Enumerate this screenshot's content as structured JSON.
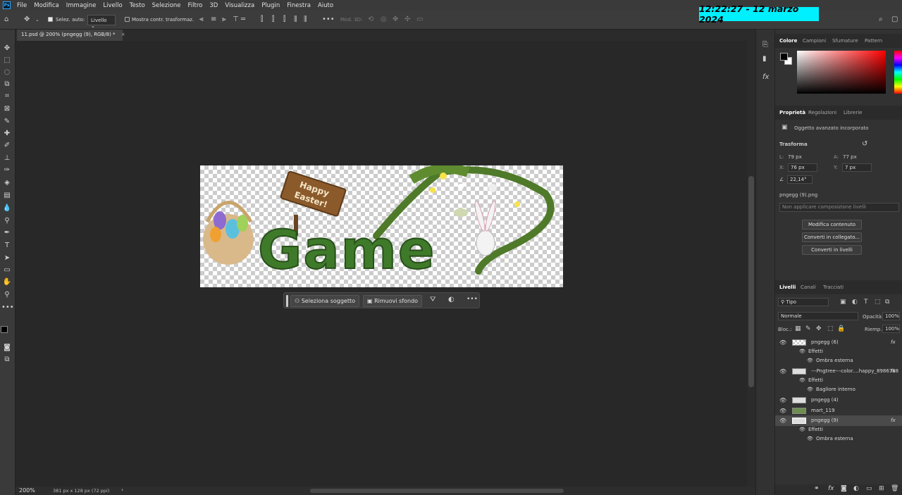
{
  "menubar": {
    "logo": "Ps",
    "items": [
      "File",
      "Modifica",
      "Immagine",
      "Livello",
      "Testo",
      "Selezione",
      "Filtro",
      "3D",
      "Visualizza",
      "Plugin",
      "Finestra",
      "Aiuto"
    ]
  },
  "clock": "12:22:27  -  12 marzo 2024",
  "options": {
    "auto_select_label": "Selez. auto:",
    "auto_select_value": "Livello",
    "transform_controls_label": "Mostra contr. trasformaz.",
    "mode_3d_label": "Mod. 3D:"
  },
  "document": {
    "tab_title": "11.psd @ 200% (pngegg (9), RGB/8) *",
    "close_glyph": "×"
  },
  "context_bar": {
    "select_subject": "Seleziona soggetto",
    "remove_background": "Rimuovi sfondo"
  },
  "artwork": {
    "sign_line1": "Happy",
    "sign_line2": "Easter!",
    "title": "Game"
  },
  "status": {
    "zoom": "200%",
    "doc_info": "381 px x 128 px (72 ppi)"
  },
  "color_panel": {
    "tabs": [
      "Colore",
      "Campioni",
      "Sfumature",
      "Pattern"
    ],
    "active_tab": "Colore",
    "foreground": "#000000",
    "background": "#ffffff"
  },
  "properties_panel": {
    "tabs": [
      "Proprietà",
      "Regolazioni",
      "Librerie"
    ],
    "type": "Oggetto avanzato incorporato",
    "transform_heading": "Trasforma",
    "width_label": "L:",
    "width": "79 px",
    "height_label": "A:",
    "height": "77 px",
    "x_label": "X:",
    "x": "76 px",
    "y_label": "Y:",
    "y": "7 px",
    "angle": "22,14°",
    "source": "pngegg (9).png",
    "composition": "Non applicare composizione livelli",
    "buttons": [
      "Modifica contenuto",
      "Converti in collegato...",
      "Converti in livelli"
    ]
  },
  "layers_panel": {
    "tabs": [
      "Livelli",
      "Canali",
      "Tracciati"
    ],
    "filter": "Tipo",
    "blend_mode": "Normale",
    "opacity_label": "Opacità:",
    "opacity": "100%",
    "lock_label": "Bloc.:",
    "fill_label": "Riemp.:",
    "fill": "100%",
    "fx_glyph": "fx",
    "layers": [
      {
        "name": "pngegg (6)",
        "effects_label": "Effetti",
        "effect": "Ombra esterna",
        "selected": false
      },
      {
        "name": "---Pngtree---color....happy_8986788",
        "effects_label": "Effetti",
        "effect": "Bagliore interno",
        "selected": false
      },
      {
        "name": "pngegg (4)",
        "selected": false
      },
      {
        "name": "mart_119",
        "selected": false
      },
      {
        "name": "pngegg (9)",
        "effects_label": "Effetti",
        "effect": "Ombra esterna",
        "selected": true
      }
    ]
  }
}
